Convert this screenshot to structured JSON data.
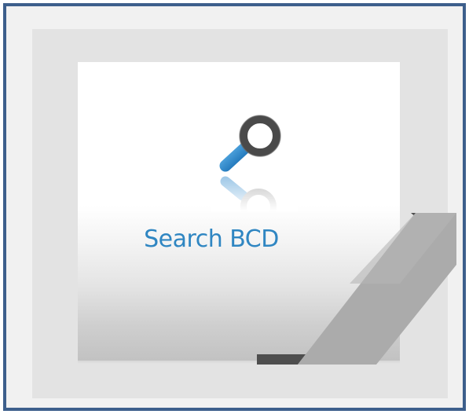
{
  "tile": {
    "label": "Search BCD",
    "icon": "search-icon"
  },
  "colors": {
    "frame_border": "#3d5f8c",
    "label_text": "#2f86c2",
    "magnifier_ring": "#444444",
    "magnifier_handle": "#1f7fc8",
    "peel_fold": "#ababab",
    "peel_dark": "#555555"
  }
}
